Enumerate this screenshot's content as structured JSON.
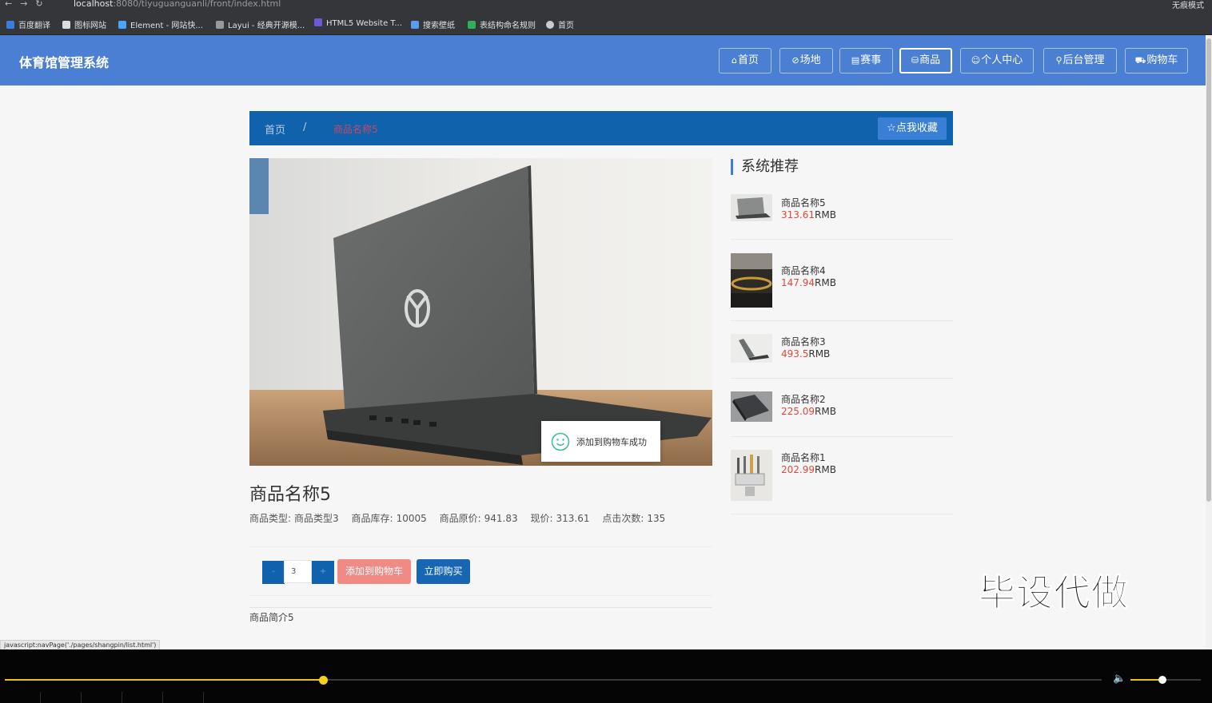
{
  "browser": {
    "url_host": "localhost",
    "url_rest": ":8080/tiyuguanguanli/front/index.html",
    "profile_label": "无痕模式",
    "bookmarks": [
      "百度翻译",
      "图标网站",
      "Element - 网站快...",
      "Layui - 经典开源模...",
      "HTML5 Website T...",
      "搜索壁纸",
      "表结构命名规则",
      "首页"
    ]
  },
  "header": {
    "brand": "体育馆管理系统",
    "nav": [
      {
        "icon": "home-icon",
        "glyph": "⌂",
        "label": "首页"
      },
      {
        "icon": "venue-icon",
        "glyph": "⊘",
        "label": "场地"
      },
      {
        "icon": "event-icon",
        "glyph": "▤",
        "label": "赛事"
      },
      {
        "icon": "product-icon",
        "glyph": "⛁",
        "label": "商品"
      },
      {
        "icon": "user-icon",
        "glyph": "☺",
        "label": "个人中心"
      },
      {
        "icon": "link-icon",
        "glyph": "⚲",
        "label": "后台管理"
      },
      {
        "icon": "cart-icon",
        "glyph": "⛟",
        "label": "购物车"
      }
    ]
  },
  "breadcrumb": {
    "home": "首页",
    "separator": "/",
    "current": "商品名称5",
    "favorite_label": "点我收藏"
  },
  "product": {
    "title": "商品名称5",
    "type_label": "商品类型:",
    "type_value": "商品类型3",
    "stock_label": "商品库存:",
    "stock_value": "10005",
    "orig_price_label": "商品原价:",
    "orig_price_value": "941.83",
    "price_label": "现价:",
    "price_value": "313.61",
    "clicks_label": "点击次数:",
    "clicks_value": "135",
    "quantity": "3",
    "minus_label": "-",
    "plus_label": "+",
    "add_cart_label": "添加到购物车",
    "buy_now_label": "立即购买",
    "description": "商品简介5"
  },
  "toast": {
    "message": "添加到购物车成功"
  },
  "recommend": {
    "title": "系统推荐",
    "currency": "RMB",
    "items": [
      {
        "name": "商品名称5",
        "price": "313.61"
      },
      {
        "name": "商品名称4",
        "price": "147.94"
      },
      {
        "name": "商品名称3",
        "price": "493.5"
      },
      {
        "name": "商品名称2",
        "price": "225.09"
      },
      {
        "name": "商品名称1",
        "price": "202.99"
      }
    ]
  },
  "status_link": "javascript:navPage('./pages/shangpin/list.html')",
  "watermark": "毕设代做",
  "colors": {
    "nav_blue": "#4a7fd3",
    "crumb_blue": "#1162ad",
    "price_red": "#e1483a",
    "add_cart": "#f08a85"
  },
  "video": {
    "progress": 0.29,
    "volume": 0.45
  }
}
